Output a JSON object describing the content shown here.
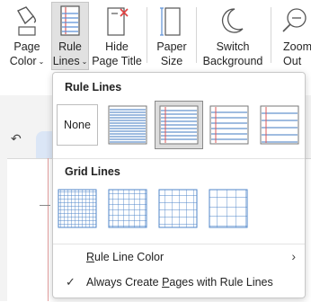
{
  "ribbon": {
    "page_color": [
      "Page",
      "Color"
    ],
    "rule_lines": [
      "Rule",
      "Lines"
    ],
    "hide_page_title": [
      "Hide",
      "Page Title"
    ],
    "paper_size": [
      "Paper",
      "Size"
    ],
    "switch_background": [
      "Switch",
      "Background"
    ],
    "zoom_out": [
      "Zoom",
      "Out"
    ]
  },
  "menu": {
    "rule_lines_title": "Rule Lines",
    "none_label": "None",
    "grid_lines_title": "Grid Lines",
    "rule_line_color": {
      "underlined": "R",
      "rest": "ule Line Color"
    },
    "always_create": {
      "before": "Always Create ",
      "underlined": "P",
      "after": "ages with Rule Lines"
    }
  },
  "colors": {
    "rule_blue": "#5b8fd6",
    "margin_red": "#e05a5a",
    "grid_blue": "#4f86c9",
    "selected_bg": "#dcdcdc"
  },
  "icons": [
    "page-color-icon",
    "rule-lines-icon",
    "hide-title-icon",
    "paper-size-icon",
    "moon-icon",
    "zoom-out-icon",
    "undo-icon",
    "chevron-right-icon",
    "checkmark-icon"
  ]
}
